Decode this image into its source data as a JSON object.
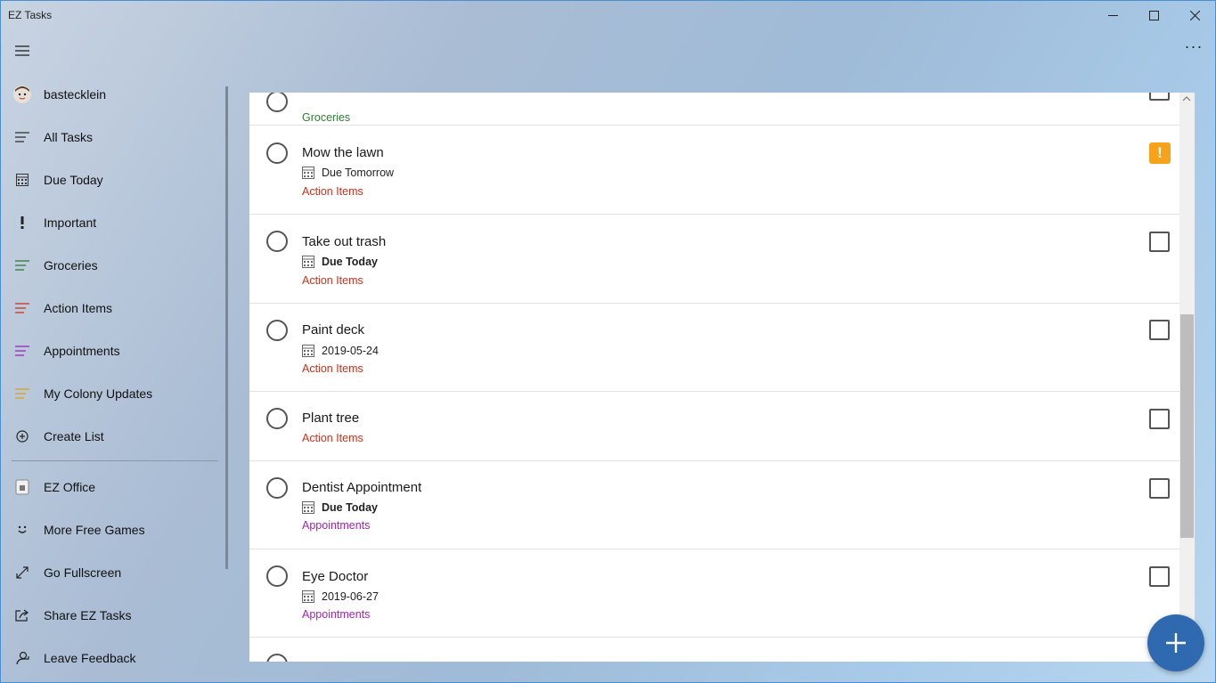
{
  "window": {
    "title": "EZ Tasks"
  },
  "colors": {
    "accent": "#2f6ab0",
    "important": "#f7a21b",
    "groceries": "#2e7d32",
    "action_items": "#c8321e",
    "appointments": "#9c27b0",
    "my_colony": "#d9a21b"
  },
  "toolbar": {
    "more_label": "···"
  },
  "sidebar": {
    "user": "bastecklein",
    "items": [
      {
        "label": "All Tasks",
        "icon": "list-icon"
      },
      {
        "label": "Due Today",
        "icon": "calendar-icon"
      },
      {
        "label": "Important",
        "icon": "exclamation-icon"
      },
      {
        "label": "Groceries",
        "icon": "list-icon"
      },
      {
        "label": "Action Items",
        "icon": "list-icon"
      },
      {
        "label": "Appointments",
        "icon": "list-icon"
      },
      {
        "label": "My Colony Updates",
        "icon": "list-icon"
      },
      {
        "label": "Create List",
        "icon": "add-circle-icon"
      }
    ],
    "extras": [
      {
        "label": "EZ Office",
        "icon": "office-icon"
      },
      {
        "label": "More Free Games",
        "icon": "smile-icon"
      },
      {
        "label": "Go Fullscreen",
        "icon": "fullscreen-icon"
      },
      {
        "label": "Share EZ Tasks",
        "icon": "share-icon"
      },
      {
        "label": "Leave Feedback",
        "icon": "feedback-icon"
      }
    ]
  },
  "tasks": [
    {
      "title": "",
      "due": "",
      "list": "Groceries"
    },
    {
      "title": "Mow the lawn",
      "due": "Due Tomorrow",
      "list": "Action Items",
      "important": true
    },
    {
      "title": "Take out trash",
      "due": "Due Today",
      "list": "Action Items"
    },
    {
      "title": "Paint deck",
      "due": "2019-05-24",
      "list": "Action Items"
    },
    {
      "title": "Plant tree",
      "due": "",
      "list": "Action Items"
    },
    {
      "title": "Dentist Appointment",
      "due": "Due Today",
      "list": "Appointments"
    },
    {
      "title": "Eye Doctor",
      "due": "2019-06-27",
      "list": "Appointments"
    }
  ],
  "fab": {
    "icon": "plus-icon"
  }
}
